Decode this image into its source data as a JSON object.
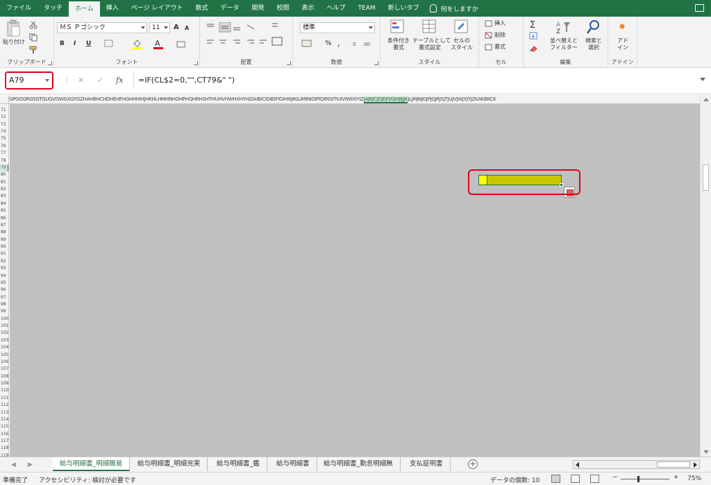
{
  "ribbon_tabs": [
    "ファイル",
    "タッチ",
    "ホーム",
    "挿入",
    "ページ レイアウト",
    "数式",
    "データ",
    "開発",
    "校閲",
    "表示",
    "ヘルプ",
    "TEAM",
    "新しいタブ"
  ],
  "active_tab": "ホーム",
  "tell_me": "何をしますか",
  "clipboard": {
    "paste": "貼り付け",
    "label": "クリップボード"
  },
  "font": {
    "name": "ＭＳ Ｐゴシック",
    "size": "11",
    "label": "フォント",
    "bold": "B",
    "italic": "I",
    "underline": "U",
    "grow": "A",
    "shrink": "A"
  },
  "alignment": {
    "label": "配置"
  },
  "number": {
    "format": "標準",
    "label": "数値",
    "percent": "%",
    "comma": ","
  },
  "styles": {
    "conditional": "条件付き\n書式",
    "conditional_1": "条件付き",
    "conditional_2": "書式",
    "table_1": "テーブルとして",
    "table_2": "書式設定",
    "cell_1": "セルの",
    "cell_2": "スタイル",
    "label": "スタイル"
  },
  "cells": {
    "insert": "挿入",
    "delete": "削除",
    "format": "書式",
    "label": "セル"
  },
  "editing": {
    "sort_1": "並べ替えと",
    "sort_2": "フィルター",
    "find_1": "検索と",
    "find_2": "選択",
    "label": "編集"
  },
  "addins": {
    "btn_1": "アド",
    "btn_2": "イン",
    "label": "アドイン"
  },
  "formula_bar": {
    "name_box": "A79",
    "cancel": "✕",
    "enter": "✓",
    "fx": "fx",
    "formula": "=IF(CL$2=0,\"\",CT79&\" \")"
  },
  "column_headers_left": "GPGOGRGSGTGUGVGWGXGYGZHAHBHCHDHEHFHGHHHIHJHKHLHMHNHOHPHQHRHSHTHUHVHWHXHYHZIAIBICIDIEIFIGIHIIIJIKILIMINIOIPIQIRISITIUIVIWIXIYIZ",
  "column_headers_selected": "JAJBJCJDJEJFJGJHJIJJJK",
  "column_headers_right": "JLJMJNJOJPJQJRJSJTJUJVJWJXJYJZKAKBKCK",
  "rows": [
    "71",
    "72",
    "73",
    "74",
    "75",
    "76",
    "77",
    "78",
    "79",
    "80",
    "81",
    "82",
    "83",
    "84",
    "85",
    "86",
    "87",
    "88",
    "89",
    "90",
    "91",
    "92",
    "93",
    "94",
    "95",
    "96",
    "97",
    "98",
    "99",
    "100",
    "101",
    "102",
    "103",
    "104",
    "105",
    "106",
    "107",
    "108",
    "109",
    "110",
    "111",
    "112",
    "113",
    "114",
    "115",
    "116",
    "117",
    "118",
    "119"
  ],
  "selected_row": "79",
  "sheet_tabs": [
    "給与明細書_明細簡易",
    "給与明細書_明細充実",
    "給与明細書_鑑",
    "給与明細書",
    "給与明細書_勤怠明細無",
    "支払証明書"
  ],
  "active_sheet": "給与明細書_明細簡易",
  "status": {
    "ready": "準備完了",
    "accessibility": "アクセシビリティ: 検討が必要です",
    "count": "データの個数: 10",
    "zoom": "75%",
    "zoom_minus": "−",
    "zoom_plus": "+"
  },
  "colors": {
    "accent": "#217346",
    "highlight": "#e0001b",
    "cell_fill": "#c8c800",
    "active_cell": "#ffff00",
    "sheet_bg": "#c0c0c0"
  }
}
